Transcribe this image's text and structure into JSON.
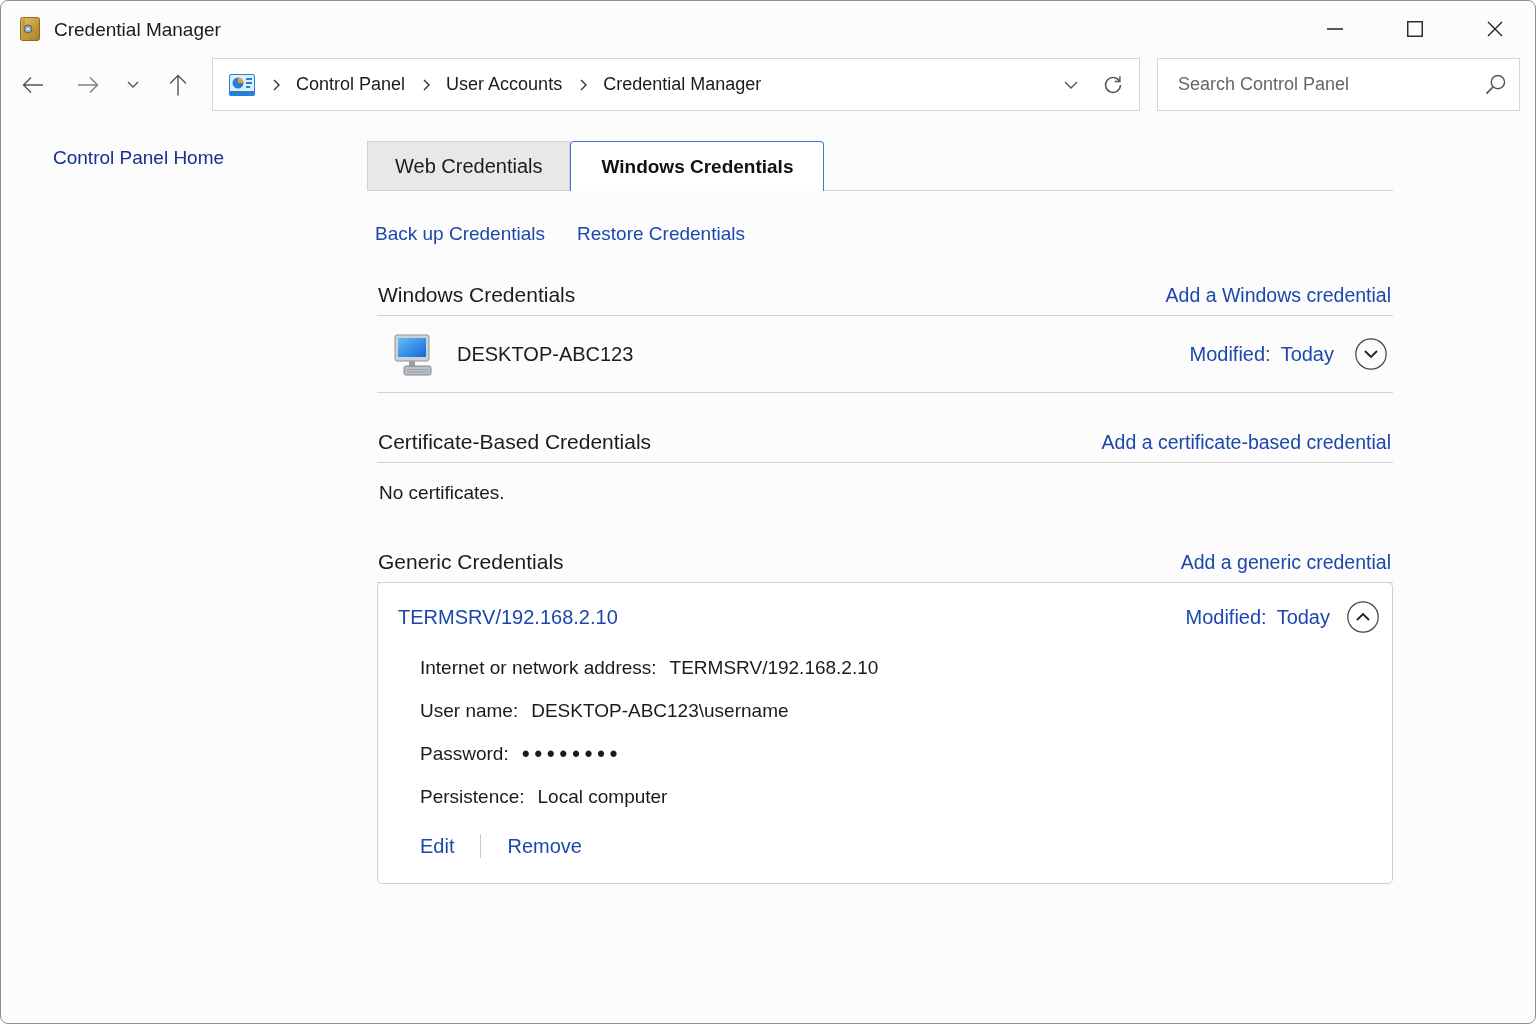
{
  "window": {
    "title": "Credential Manager"
  },
  "address_bar": {
    "path": [
      "Control Panel",
      "User Accounts",
      "Credential Manager"
    ]
  },
  "search": {
    "placeholder": "Search Control Panel"
  },
  "sidebar": {
    "links": [
      "Control Panel Home"
    ]
  },
  "tabs": [
    {
      "label": "Web Credentials",
      "selected": false
    },
    {
      "label": "Windows Credentials",
      "selected": true
    }
  ],
  "actions": [
    "Back up Credentials",
    "Restore Credentials"
  ],
  "sections": [
    {
      "title": "Windows Credentials",
      "add_link": "Add a Windows credential",
      "items": [
        {
          "kind": "computer",
          "name": "DESKTOP-ABC123",
          "modified_label": "Modified:",
          "modified": "Today",
          "expanded": false
        }
      ]
    },
    {
      "title": "Certificate-Based Credentials",
      "add_link": "Add a certificate-based credential",
      "empty_text": "No certificates."
    },
    {
      "title": "Generic Credentials",
      "add_link": "Add a generic credential",
      "items": [
        {
          "kind": "generic",
          "name": "TERMSRV/192.168.2.10",
          "modified_label": "Modified:",
          "modified": "Today",
          "expanded": true,
          "details": [
            {
              "kind": "text",
              "label": "Internet or network address:",
              "value": "TERMSRV/192.168.2.10"
            },
            {
              "kind": "text",
              "label": "User name:",
              "value": "DESKTOP-ABC123\\username"
            },
            {
              "kind": "password",
              "label": "Password:",
              "value": "••••••••"
            },
            {
              "kind": "text",
              "label": "Persistence:",
              "value": "Local computer"
            }
          ],
          "actions": [
            "Edit",
            "Remove"
          ]
        }
      ]
    }
  ]
}
